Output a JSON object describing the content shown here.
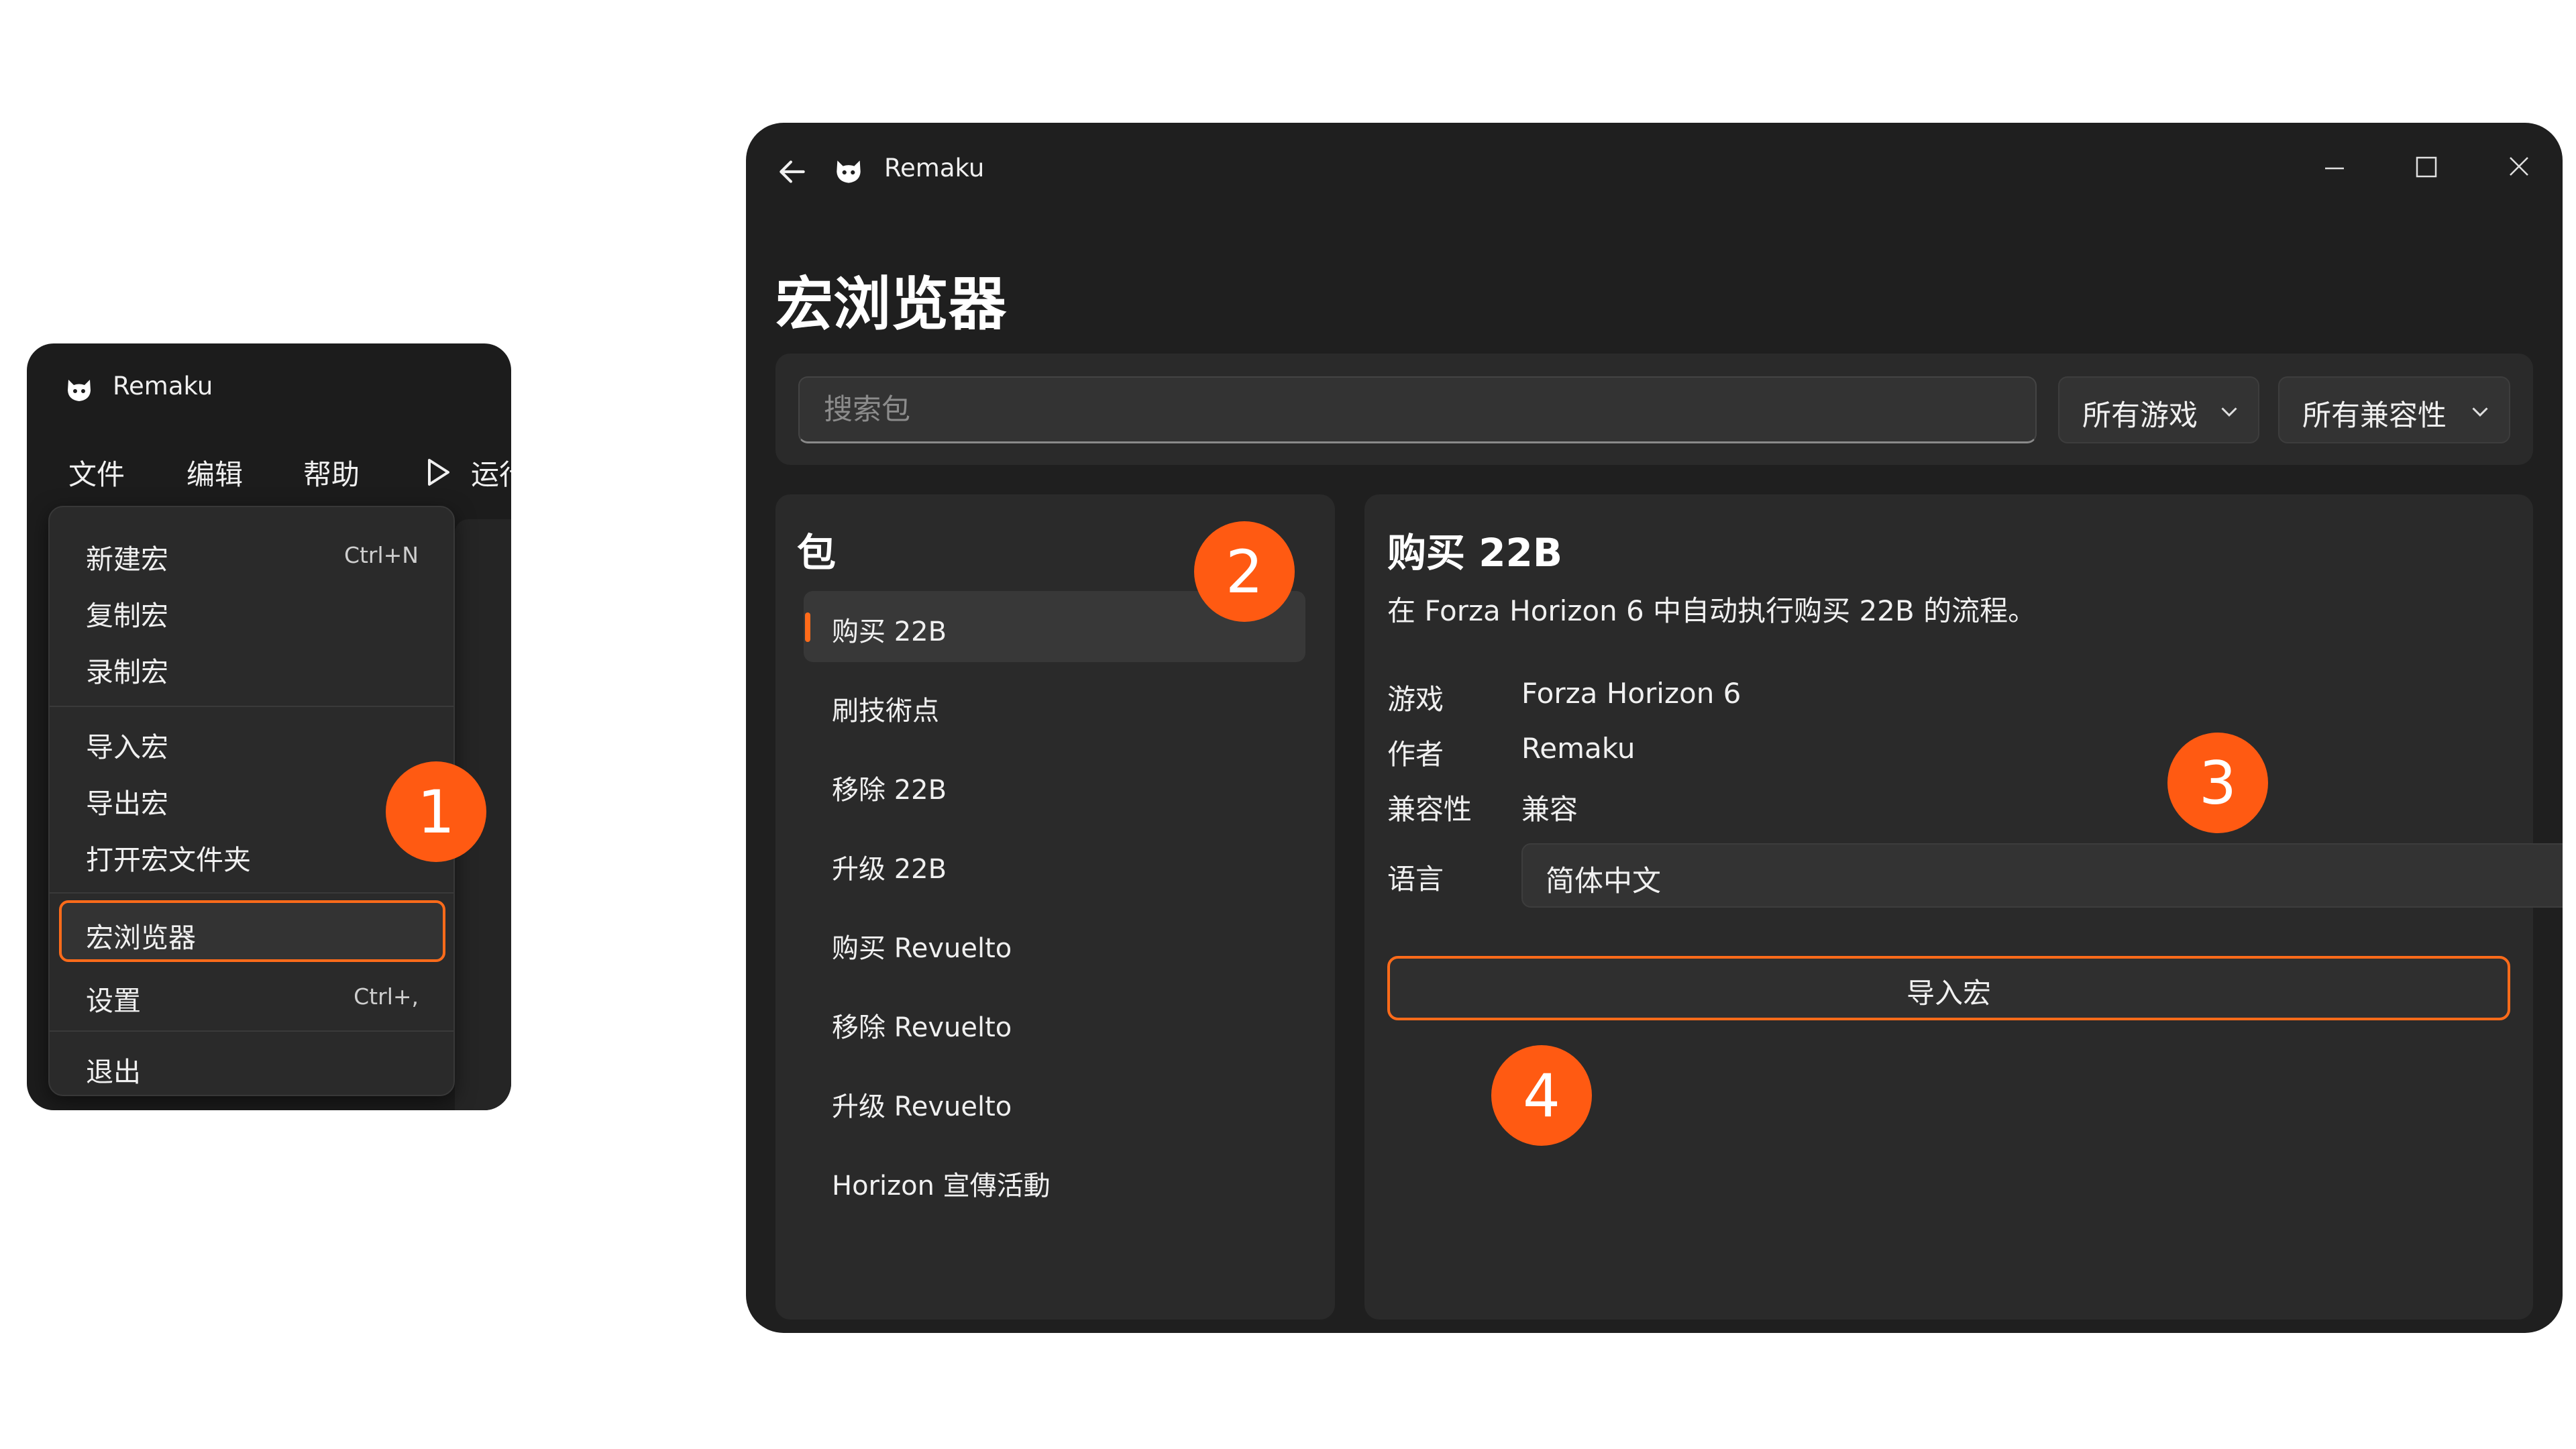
{
  "app": {
    "name": "Remaku"
  },
  "small_window": {
    "title": "Remaku",
    "menubar": {
      "file": "文件",
      "edit": "编辑",
      "help": "帮助",
      "run": "运行"
    },
    "dropdown": {
      "new_macro": {
        "label": "新建宏",
        "shortcut": "Ctrl+N"
      },
      "duplicate_macro": "复制宏",
      "record_macro": "录制宏",
      "import_macro": "导入宏",
      "export_macro": "导出宏",
      "open_folder": "打开宏文件夹",
      "macro_browser": "宏浏览器",
      "settings": {
        "label": "设置",
        "shortcut": "Ctrl+,"
      },
      "exit": "退出"
    }
  },
  "main_window": {
    "title": "Remaku",
    "page_title": "宏浏览器",
    "search": {
      "placeholder": "搜索包",
      "value": ""
    },
    "filters": {
      "games": "所有游戏",
      "compatibility": "所有兼容性"
    },
    "packages": {
      "heading": "包",
      "items": [
        {
          "label": "购买 22B",
          "selected": true
        },
        {
          "label": "刷技術点"
        },
        {
          "label": "移除 22B"
        },
        {
          "label": "升级 22B"
        },
        {
          "label": "购买 Revuelto"
        },
        {
          "label": "移除 Revuelto"
        },
        {
          "label": "升级 Revuelto"
        },
        {
          "label": "Horizon 宣傳活動"
        }
      ]
    },
    "detail": {
      "title": "购买 22B",
      "description": "在 Forza Horizon 6 中自动执行购买 22B 的流程。",
      "meta": {
        "game": {
          "key": "游戏",
          "value": "Forza Horizon 6"
        },
        "author": {
          "key": "作者",
          "value": "Remaku"
        },
        "compat": {
          "key": "兼容性",
          "value": "兼容"
        },
        "language": {
          "key": "语言",
          "value": "简体中文"
        }
      },
      "import_button": "导入宏"
    }
  },
  "callouts": [
    "1",
    "2",
    "3",
    "4"
  ],
  "colors": {
    "accent": "#ff6b1a",
    "callout": "#ff5a12",
    "window_bg": "#1f1f1f",
    "panel_bg": "#2a2a2a"
  }
}
